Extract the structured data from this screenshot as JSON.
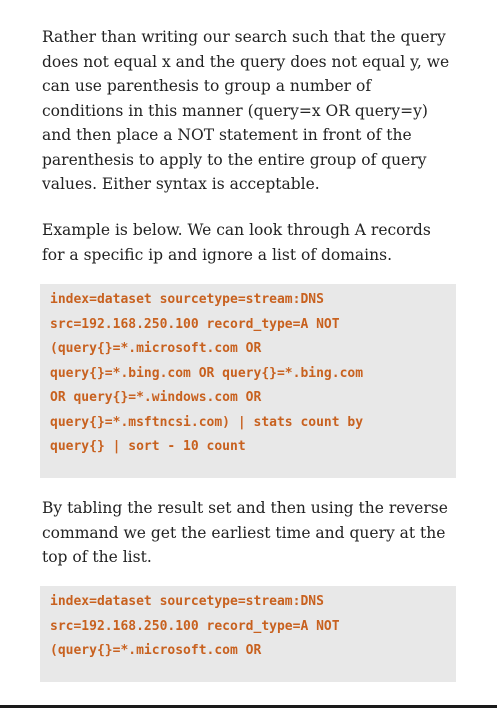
{
  "paragraph1": {
    "lines": [
      "Rather than writing our search such that the query",
      "does not equal x and the query does not equal y, we",
      "can use parenthesis to group a number of",
      "conditions in this manner (query=x OR query=y)",
      "and then place a NOT statement in front of the",
      "parenthesis to apply to the entire group of query",
      "values. Either syntax is acceptable."
    ]
  },
  "paragraph2": {
    "lines": [
      "Example is below. We can look through A records",
      "for a specific ip and ignore a list of domains."
    ]
  },
  "code1": {
    "lines": [
      "index=dataset sourcetype=stream:DNS",
      "src=192.168.250.100 record_type=A NOT",
      "(query{}=*.microsoft.com OR",
      "query{}=*.bing.com OR query{}=*.bing.com",
      "OR query{}=*.windows.com OR",
      "query{}=*.msftncsi.com) | stats count by",
      "query{} | sort - 10 count"
    ]
  },
  "paragraph3": {
    "lines": [
      "By tabling the result set and then using the reverse",
      "command we get the earliest time and query at the",
      "top of the list."
    ]
  },
  "code2": {
    "lines": [
      "index=dataset sourcetype=stream:DNS",
      "src=192.168.250.100 record_type=A NOT",
      "(query{}=*.microsoft.com OR"
    ]
  },
  "colors": {
    "body_text": "#222222",
    "code_text": "#c8611f",
    "code_background": "#e8e8e8"
  }
}
